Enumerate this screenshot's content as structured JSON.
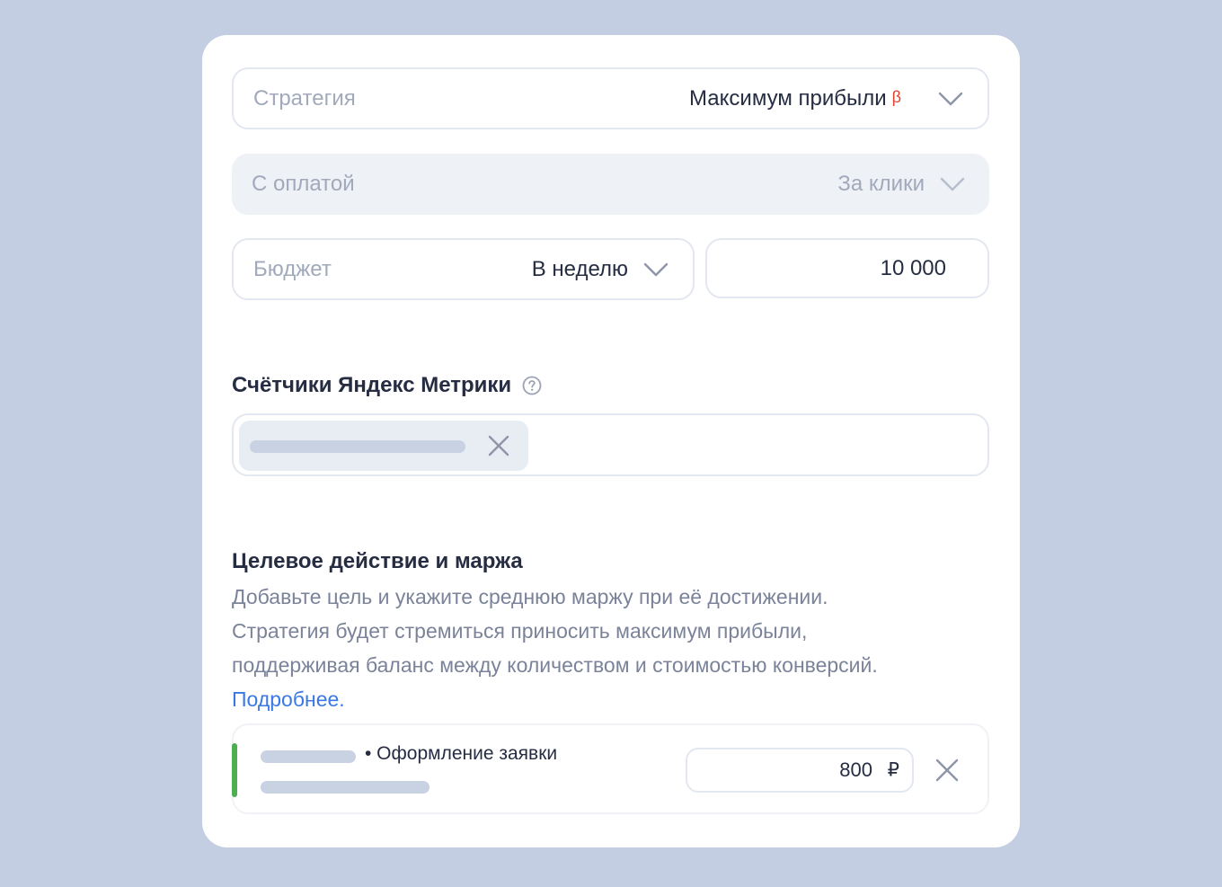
{
  "strategy": {
    "label": "Стратегия",
    "value": "Максимум прибыли",
    "badge": "β",
    "icon": "chevron-down-icon"
  },
  "payment": {
    "label": "С оплатой",
    "value": "За клики",
    "icon": "chevron-down-icon"
  },
  "budget": {
    "label": "Бюджет",
    "period": "В неделю",
    "amount": "10 000",
    "icon": "chevron-down-icon"
  },
  "metrika": {
    "title": "Счётчики Яндекс Метрики",
    "help_icon": "question-circle-icon",
    "remove_icon": "close-icon"
  },
  "goal": {
    "title": "Целевое действие и маржа",
    "description_lines": [
      "Добавьте цель и укажите среднюю маржу при её достижении.",
      "Стратегия будет стремиться приносить максимум прибыли,",
      "поддерживая баланс между количеством и стоимостью конверсий."
    ],
    "more_link": "Подробнее",
    "more_suffix": ".",
    "item": {
      "name": "• Оформление заявки",
      "margin": "800",
      "currency": "₽",
      "remove_icon": "close-icon"
    }
  },
  "colors": {
    "background": "#c3cee2",
    "card": "#ffffff",
    "accent_link": "#3a78e6",
    "beta_badge": "#e1412f",
    "goal_accent": "#4caf50",
    "placeholder": "#c9d2e3"
  }
}
